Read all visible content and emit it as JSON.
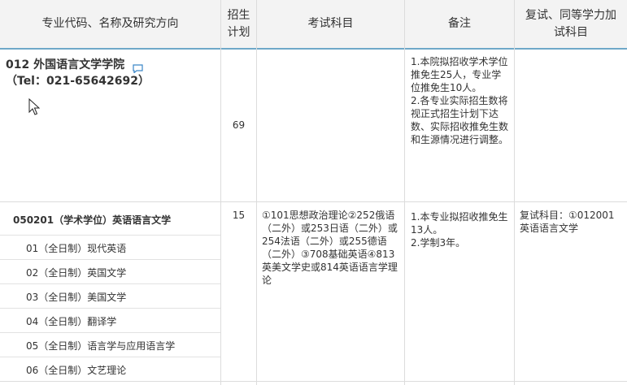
{
  "header": {
    "col1": "专业代码、名称及研究方向",
    "col2_line1": "招生",
    "col2_line2": "计划",
    "col3": "考试科目",
    "col4": "备注",
    "col5_line1": "复试、同等学力加",
    "col5_line2": "试科目"
  },
  "department": {
    "name": "012 外国语言文学学院",
    "tel": "（Tel：021-65642692）",
    "comment_icon": "comment-icon",
    "quota": "69",
    "remarks": "1.本院拟招收学术学位推免生25人，专业学位推免生10人。\n2.各专业实际招生数将视正式招生计划下达数、实际招收推免生数和生源情况进行调整。"
  },
  "major": {
    "name": "050201（学术学位）英语语言文学",
    "quota": "15",
    "exam_subjects": "①101思想政治理论②252俄语（二外）或253日语（二外）或254法语（二外）或255德语（二外）③708基础英语④813英美文学史或814英语语言学理论",
    "remarks": "1.本专业拟招收推免生13人。\n2.学制3年。",
    "retest": "复试科目：①012001英语语言文学",
    "directions": [
      "01（全日制）现代英语",
      "02（全日制）英国文学",
      "03（全日制）美国文学",
      "04（全日制）翻译学",
      "05（全日制）语言学与应用语言学",
      "06（全日制）文艺理论"
    ]
  },
  "colors": {
    "header_bg": "#f3f3f3",
    "header_accent": "#6fa8c8",
    "grid": "#dcdcdc",
    "icon": "#3a86c8"
  }
}
